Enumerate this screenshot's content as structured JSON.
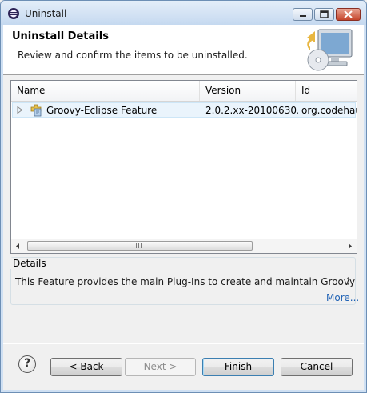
{
  "window": {
    "title": "Uninstall",
    "controls": {
      "minimize": "minimize-icon",
      "maximize": "maximize-icon",
      "close": "close-icon"
    }
  },
  "banner": {
    "title": "Uninstall Details",
    "description": "Review and confirm the items to be uninstalled.",
    "image": "uninstall-wizard-icon"
  },
  "table": {
    "columns": [
      "Name",
      "Version",
      "Id"
    ],
    "rows": [
      {
        "name": "Groovy-Eclipse Feature",
        "version": "2.0.2.xx-20100630...",
        "id": "org.codehaus",
        "icon": "feature-icon",
        "expanded": false
      }
    ],
    "scrollbar": {
      "horizontal": true
    }
  },
  "details": {
    "label": "Details",
    "text": "This Feature provides the main Plug-Ins to create and maintain Groovy",
    "more_link": "More..."
  },
  "buttons": {
    "help": "help-icon",
    "back": "< Back",
    "next": "Next >",
    "finish": "Finish",
    "cancel": "Cancel",
    "next_enabled": false,
    "default": "Finish"
  },
  "colors": {
    "title_bar": "#c5d9f0",
    "close_button": "#c5452c",
    "link": "#1f62b5",
    "selection_row": "#eaf4fc"
  }
}
